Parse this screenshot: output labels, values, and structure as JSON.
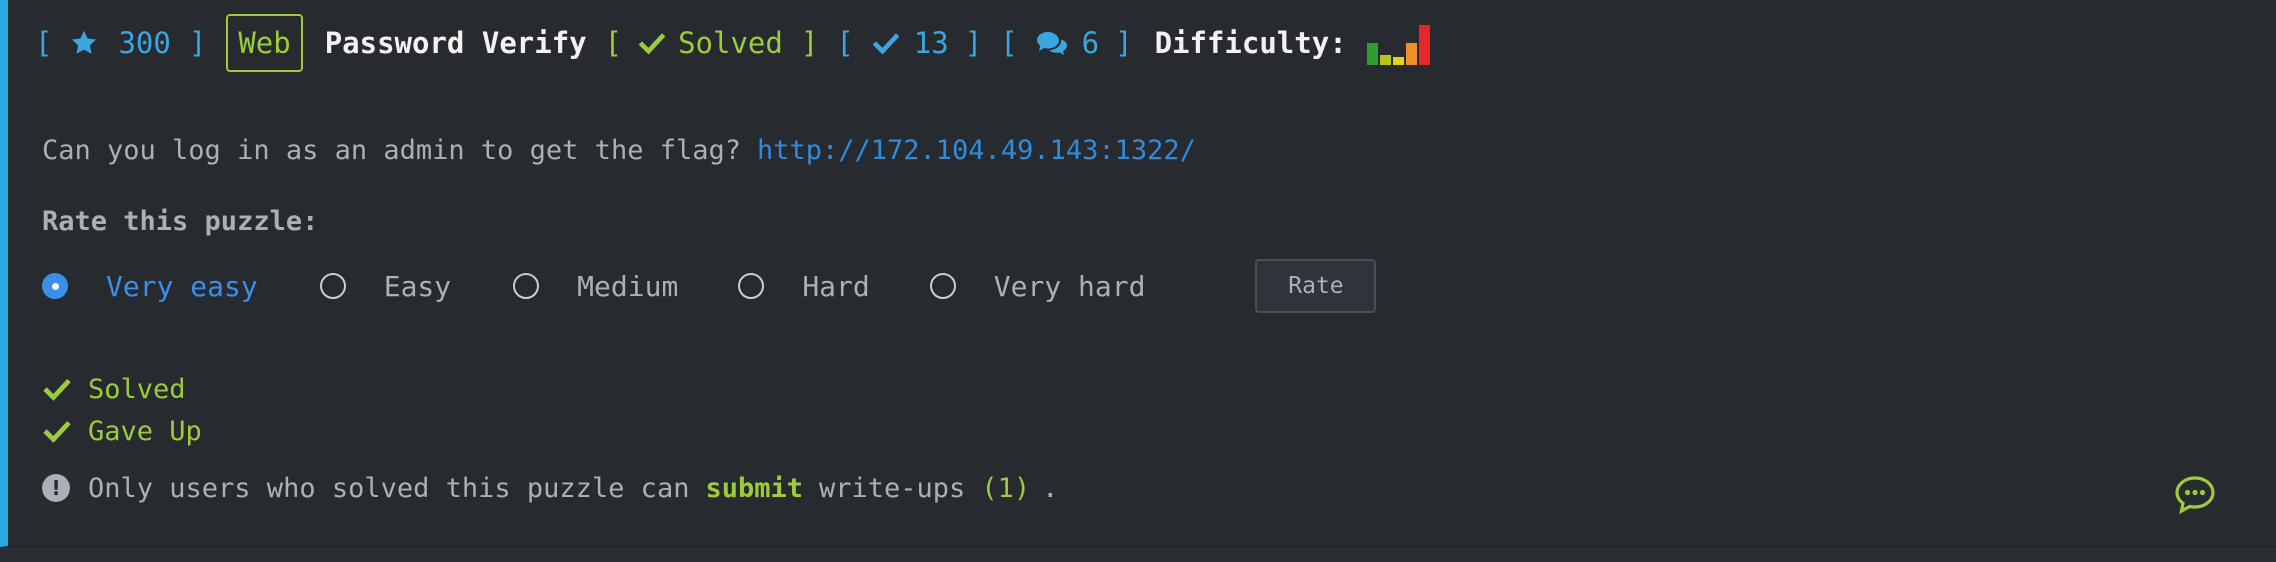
{
  "header": {
    "bracket_open": "[",
    "bracket_close": "]",
    "points": "300",
    "category": "Web",
    "title": "Password Verify",
    "solved_status": "Solved",
    "solves_count": "13",
    "comments_count": "6",
    "difficulty_label": "Difficulty:",
    "difficulty_level_fraction": 0.8,
    "icons": [
      "star-icon",
      "check-icon",
      "check-icon",
      "comments-icon"
    ]
  },
  "puzzle": {
    "description": "Can you log in as an admin to get the flag?",
    "link": "http://172.104.49.143:1322/"
  },
  "rating": {
    "title": "Rate this puzzle:",
    "options": [
      "Very easy",
      "Easy",
      "Medium",
      "Hard",
      "Very hard"
    ],
    "selected": "Very easy",
    "button_label": "Rate"
  },
  "status": {
    "solved": "Solved",
    "gave_up": "Gave Up"
  },
  "writeups": {
    "text_before": "Only users who solved this puzzle can",
    "submit_link": "submit",
    "text_after": "write-ups",
    "count": "(1)",
    "period": "."
  },
  "colors": {
    "accent_blue": "#3aa6df",
    "accent_green": "#9ccb3b",
    "link_blue": "#2f8bdd",
    "difficulty_bars": [
      "#2e9e2e",
      "#b8c716",
      "#e6d21a",
      "#f0902a",
      "#e8262a"
    ]
  }
}
